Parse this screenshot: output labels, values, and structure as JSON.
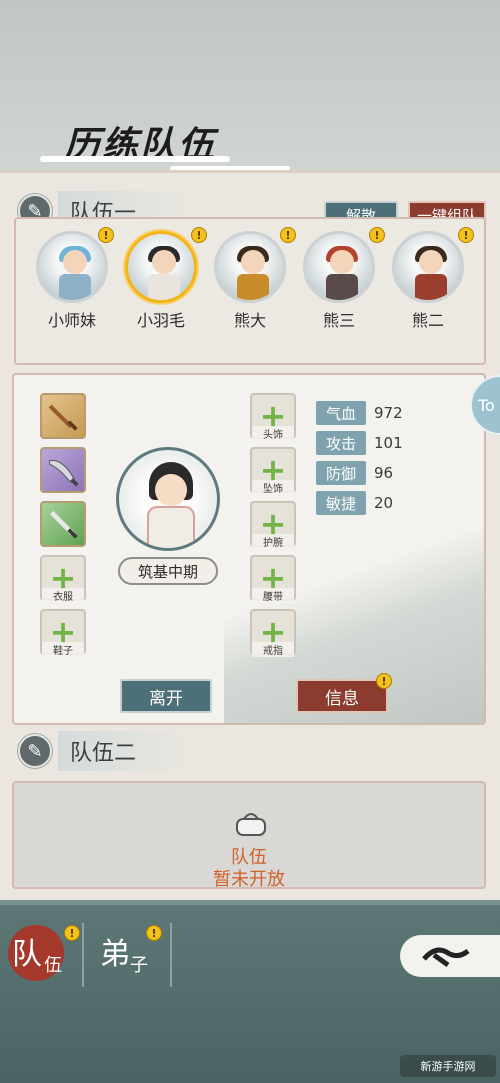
{
  "banner": {
    "title": "历练队伍"
  },
  "team1": {
    "label": "队伍一",
    "disband_label": "解散",
    "auto_form_label": "一键组队",
    "members": [
      {
        "name": "小师妹",
        "alert": "!",
        "hair": "#6fb3d9",
        "body": "#8fb1c8"
      },
      {
        "name": "小羽毛",
        "alert": "!",
        "hair": "#2a2a2a",
        "body": "#e9e4dd",
        "selected": true
      },
      {
        "name": "熊大",
        "alert": "!",
        "hair": "#3b2a1c",
        "body": "#c88d2a"
      },
      {
        "name": "熊三",
        "alert": "!",
        "hair": "#b3432c",
        "body": "#5a4b4a"
      },
      {
        "name": "熊二",
        "alert": "!",
        "hair": "#3b2a1c",
        "body": "#9a3f2e"
      }
    ]
  },
  "detail": {
    "realm": "筑基中期",
    "left_slots": [
      {
        "label": "",
        "type": "weapon",
        "variant": "w1"
      },
      {
        "label": "",
        "type": "weapon",
        "variant": "w2"
      },
      {
        "label": "",
        "type": "weapon",
        "variant": "w3"
      },
      {
        "label": "衣服",
        "type": "empty"
      },
      {
        "label": "鞋子",
        "type": "empty"
      }
    ],
    "right_slots": [
      {
        "label": "头饰"
      },
      {
        "label": "坠饰"
      },
      {
        "label": "护腕"
      },
      {
        "label": "腰带"
      },
      {
        "label": "戒指"
      }
    ],
    "stats": [
      {
        "key": "气血",
        "value": "972"
      },
      {
        "key": "攻击",
        "value": "101"
      },
      {
        "key": "防御",
        "value": "96"
      },
      {
        "key": "敏捷",
        "value": "20"
      }
    ],
    "leave_label": "离开",
    "info_label": "信息",
    "info_alert": "!"
  },
  "side_tab": {
    "label": "To"
  },
  "team2": {
    "label": "队伍二",
    "locked_line1": "队伍",
    "locked_line2": "暂未开放"
  },
  "bottom": {
    "tab_team_big": "队",
    "tab_team_small": "伍",
    "tab_team_alert": "!",
    "tab_disciple_big": "弟",
    "tab_disciple_small": "子",
    "tab_disciple_alert": "!",
    "watermark": "新游手游网"
  },
  "colors": {
    "accent_teal": "#4d6f78",
    "accent_red": "#8b3c2f",
    "alert_yellow": "#f3c21b"
  }
}
